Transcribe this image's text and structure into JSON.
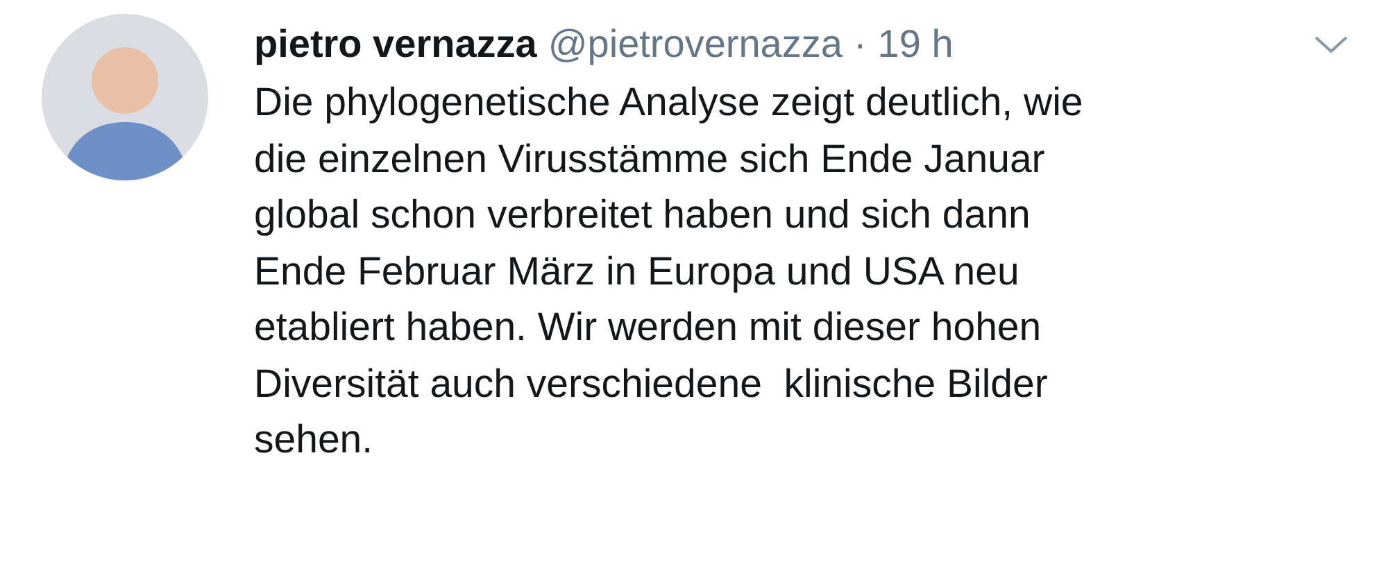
{
  "tweet": {
    "author_name": "pietro vernazza",
    "handle": "@pietrovernazza",
    "separator": "·",
    "time": "19 h",
    "text": "Die phylogenetische Analyse zeigt deutlich, wie\ndie einzelnen Virusstämme sich Ende Januar\nglobal schon verbreitet haben und sich dann\nEnde Februar März in Europa und USA neu\netabliert haben. Wir werden mit dieser hohen\nDiversität auch verschiedene  klinische Bilder\nsehen."
  }
}
